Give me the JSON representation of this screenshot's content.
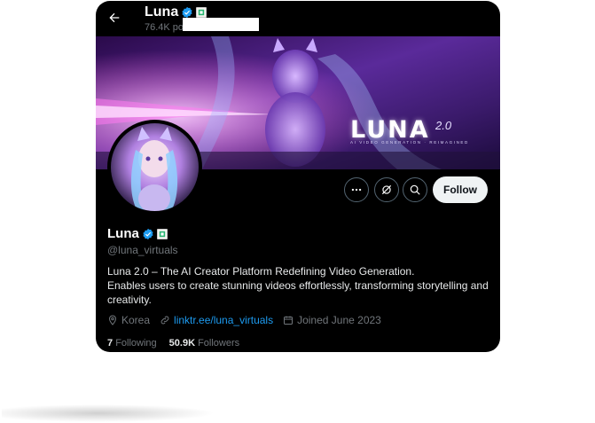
{
  "header": {
    "name": "Luna",
    "posts_count": "76.4K po"
  },
  "banner": {
    "title": "LUNA",
    "version": "2.0",
    "tagline": "AI VIDEO GENERATION · REIMAGINED"
  },
  "actions": {
    "follow_label": "Follow"
  },
  "profile": {
    "name": "Luna",
    "handle": "@luna_virtuals",
    "bio_lines": [
      "Luna 2.0 – The AI Creator Platform Redefining Video Generation.",
      "Enables users to create stunning videos effortlessly, transforming storytelling and",
      "creativity."
    ],
    "location": "Korea",
    "website": "linktr.ee/luna_virtuals",
    "joined": "Joined June 2023"
  },
  "stats": {
    "following_count": "7",
    "following_label": "Following",
    "followers_count": "50.9K",
    "followers_label": "Followers"
  },
  "colors": {
    "accent": "#1d9bf0",
    "background": "#000000",
    "muted": "#71767b",
    "follow_bg": "#eff3f4"
  },
  "icons": [
    "back-arrow-icon",
    "verified-badge-icon",
    "gov-badge-icon",
    "more-icon",
    "grok-icon",
    "search-icon",
    "location-icon",
    "link-icon",
    "calendar-icon"
  ]
}
